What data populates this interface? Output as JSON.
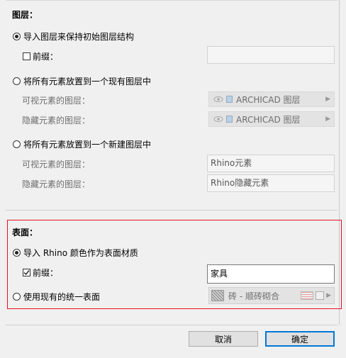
{
  "layers_section": {
    "title": "图层：",
    "option_import_structure": "导入图层来保持初始图层结构",
    "prefix_label": "前缀：",
    "prefix_value": "",
    "option_existing_layer": "将所有元素放置到一个现有图层中",
    "visible_layer_label": "可视元素的图层：",
    "visible_layer_value": "ARCHICAD 图层",
    "hidden_layer_label": "隐藏元素的图层：",
    "hidden_layer_value": "ARCHICAD 图层",
    "option_new_layer": "将所有元素放置到一个新建图层中",
    "new_visible_layer_label": "可视元素的图层：",
    "new_visible_layer_value": "Rhino元素",
    "new_hidden_layer_label": "隐藏元素的图层：",
    "new_hidden_layer_value": "Rhino隐藏元素"
  },
  "surface_section": {
    "title": "表面：",
    "option_import_rhino_color": "导入 Rhino 颜色作为表面材质",
    "prefix_label": "前缀：",
    "prefix_value": "家具",
    "option_use_existing": "使用现有的统一表面",
    "surface_value": "砖 - 顺砖砌合"
  },
  "buttons": {
    "cancel": "取消",
    "ok": "确定"
  },
  "colors": {
    "highlight_border": "#e81123",
    "default_button_border": "#0078d7"
  }
}
